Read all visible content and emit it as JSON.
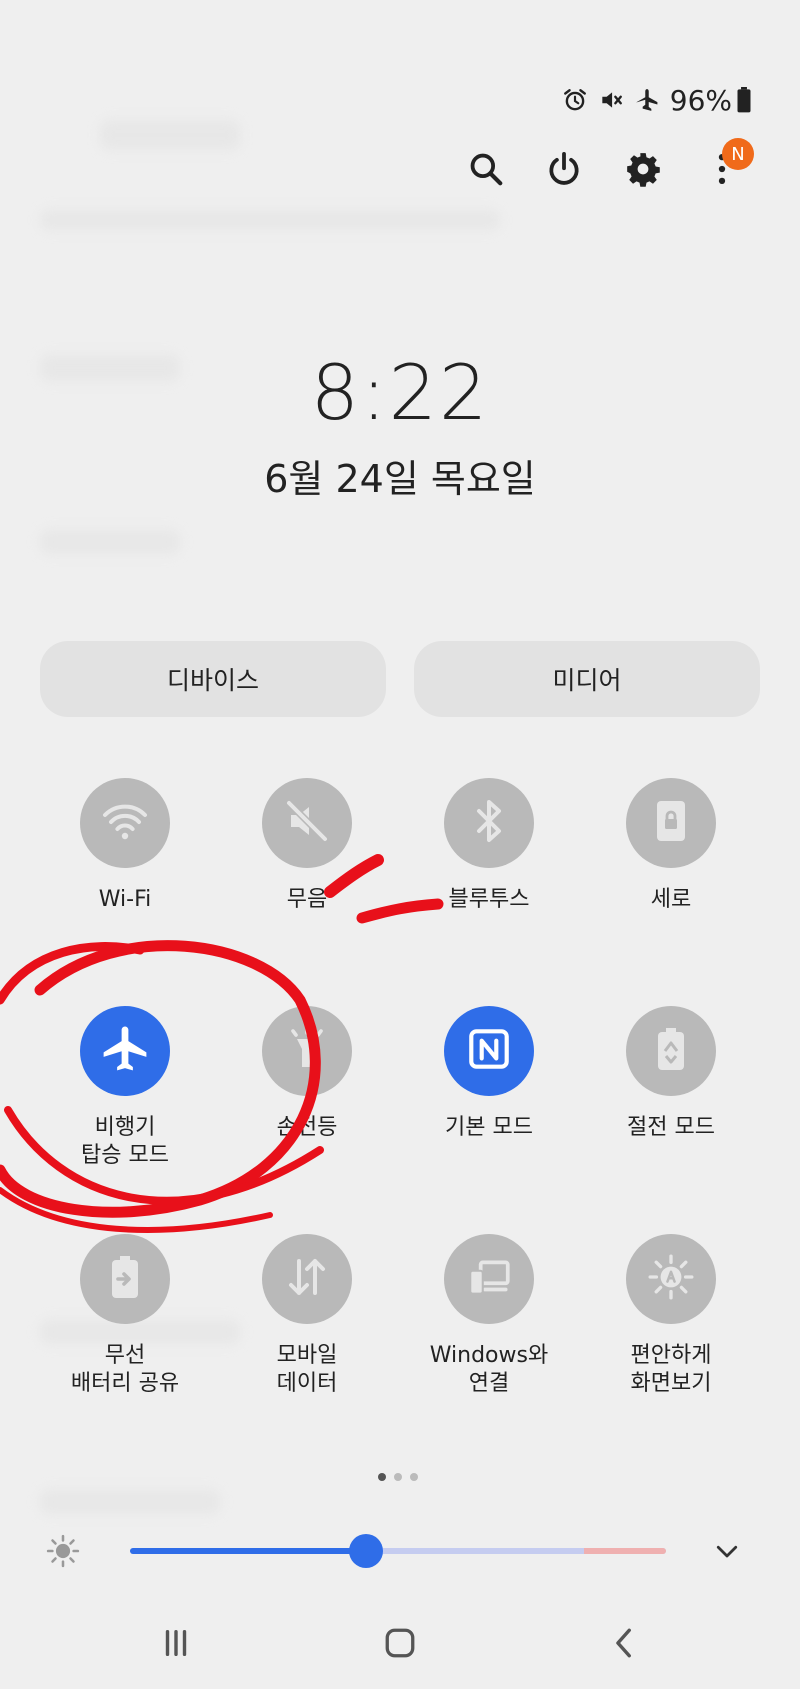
{
  "status_bar": {
    "icons": [
      "alarm-icon",
      "mute-icon",
      "airplane-icon",
      "battery-icon"
    ],
    "battery_percent": "96%"
  },
  "top_actions": {
    "icons": [
      "search-icon",
      "power-icon",
      "gear-icon",
      "more-icon"
    ],
    "notification_badge": "N"
  },
  "clock": {
    "time": "8:22",
    "date": "6월 24일 목요일"
  },
  "buttons": {
    "device": "디바이스",
    "media": "미디어"
  },
  "tiles": [
    {
      "label": "Wi-Fi",
      "icon": "wifi-icon",
      "active": false
    },
    {
      "label": "무음",
      "icon": "mute-icon",
      "active": false
    },
    {
      "label": "블루투스",
      "icon": "bluetooth-icon",
      "active": false
    },
    {
      "label": "세로",
      "icon": "portrait-lock-icon",
      "active": false
    },
    {
      "label": "비행기\n탑승 모드",
      "icon": "airplane-icon",
      "active": true
    },
    {
      "label": "손전등",
      "icon": "flashlight-icon",
      "active": false
    },
    {
      "label": "기본 모드",
      "icon": "nfc-icon",
      "active": true
    },
    {
      "label": "절전 모드",
      "icon": "power-saving-icon",
      "active": false
    },
    {
      "label": "무선\n배터리 공유",
      "icon": "wireless-battery-share-icon",
      "active": false
    },
    {
      "label": "모바일\n데이터",
      "icon": "mobile-data-icon",
      "active": false
    },
    {
      "label": "Windows와\n연결",
      "icon": "link-to-windows-icon",
      "active": false
    },
    {
      "label": "편안하게\n화면보기",
      "icon": "eye-comfort-icon",
      "active": false
    }
  ],
  "page_indicator": {
    "count": 3,
    "current": 1
  },
  "brightness": {
    "level": 0.44
  },
  "navigation": {
    "icons": [
      "recent-apps-icon",
      "home-icon",
      "back-icon"
    ]
  },
  "colors": {
    "accent": "#2f6de8",
    "inactive_tile": "#b9b9b9",
    "badge": "#f06a1a",
    "annotation": "#e8101a"
  }
}
